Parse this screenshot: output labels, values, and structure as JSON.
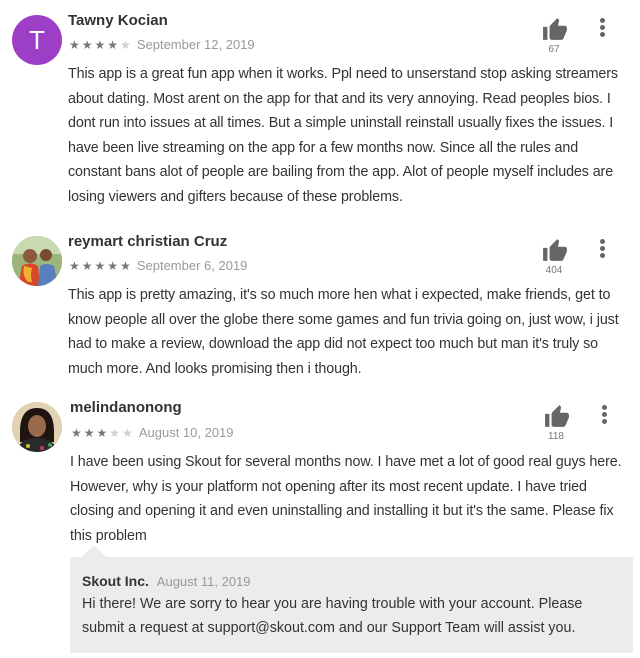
{
  "reviews": [
    {
      "avatar_letter": "T",
      "avatar_color": "#9c3fc6",
      "name": "Tawny Kocian",
      "stars": 4,
      "date": "September 12, 2019",
      "likes": "67",
      "text": "This app is a great fun app when it works. Ppl need to unserstand stop asking streamers about dating. Most arent on the app for that and its very annoying. Read peoples bios. I dont run into issues at all times. But a simple uninstall reinstall usually fixes the issues. I have been live streaming on the app for a few months now. Since all the rules and constant bans alot of people are bailing from the app. Alot of people myself includes are losing viewers and gifters because of these problems."
    },
    {
      "name": "reymart christian Cruz",
      "stars": 5,
      "date": "September 6, 2019",
      "likes": "404",
      "text": "This app is pretty amazing, it's so much more hen what i expected, make friends, get to know people all over the globe there some games and fun trivia going on, just wow, i just had to make a review, download the app did not expect too much but man it's truly so much more. And looks promising then i though."
    },
    {
      "name": "melindanonong",
      "stars": 3,
      "date": "August 10, 2019",
      "likes": "118",
      "text": "I have been using Skout for several months now. I have met a lot of good real guys here. However, why is your platform not opening after its most recent update. I have tried closing and opening it and even uninstalling and installing it but it's the same. Please fix this problem"
    }
  ],
  "developer_reply": {
    "name": "Skout Inc.",
    "date": "August 11, 2019",
    "text": "Hi there! We are sorry to hear you are having trouble with your account. Please submit a request at support@skout.com and our Support Team will assist you."
  },
  "icons": {
    "like": "thumbs-up-icon",
    "more": "more-vertical-icon",
    "star": "star-icon"
  }
}
